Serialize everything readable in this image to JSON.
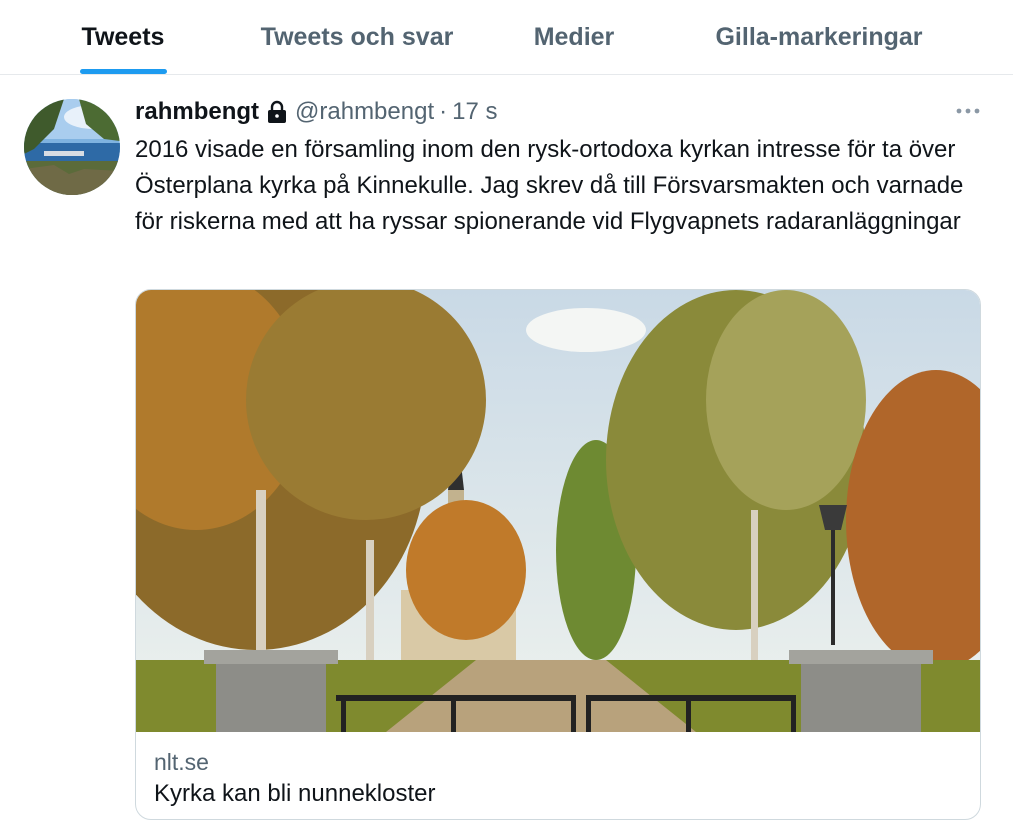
{
  "tabs": [
    {
      "label": "Tweets",
      "active": true
    },
    {
      "label": "Tweets och svar",
      "active": false
    },
    {
      "label": "Medier",
      "active": false
    },
    {
      "label": "Gilla-markeringar",
      "active": false
    }
  ],
  "tweet": {
    "display_name": "rahmbengt",
    "locked_icon": "lock-icon",
    "handle": "@rahmbengt",
    "separator": "·",
    "time": "17 s",
    "more_icon": "more-icon",
    "text": "2016 visade en församling inom den rysk-ortodoxa kyrkan intresse för ta över Österplana kyrka på Kinnekulle. Jag skrev då till Försvarsmakten och varnade för riskerna med att ha ryssar spionerande vid Flygvapnets radaranläggningar",
    "card": {
      "domain": "nlt.se",
      "title": "Kyrka kan bli nunnekloster"
    }
  },
  "colors": {
    "accent": "#1d9bf0",
    "text_primary": "#0f1419",
    "text_secondary": "#536471",
    "border": "#cfd9de"
  }
}
